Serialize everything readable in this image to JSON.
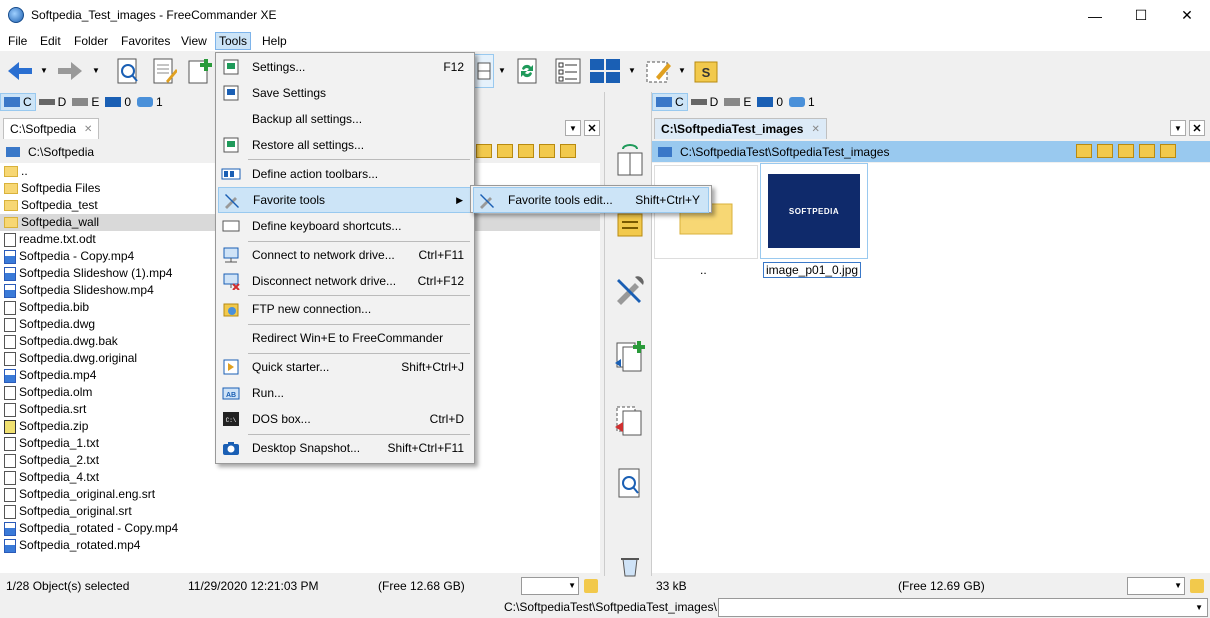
{
  "window": {
    "title": "Softpedia_Test_images - FreeCommander XE",
    "minimize": "—",
    "maximize": "☐",
    "close": "✕"
  },
  "menu": [
    "File",
    "Edit",
    "Folder",
    "Favorites",
    "View",
    "Tools",
    "Help"
  ],
  "left": {
    "drives": [
      "C",
      "D",
      "E",
      "0",
      "1"
    ],
    "tab": "C:\\Softpedia",
    "path": "C:\\Softpedia",
    "files": [
      {
        "name": "..",
        "type": "folder"
      },
      {
        "name": "Softpedia Files",
        "type": "folder"
      },
      {
        "name": "Softpedia_test",
        "type": "folder"
      },
      {
        "name": "Softpedia_wall",
        "type": "folder"
      },
      {
        "name": "readme.txt.odt",
        "type": "file"
      },
      {
        "name": "Softpedia - Copy.mp4",
        "type": "media"
      },
      {
        "name": "Softpedia Slideshow (1).mp4",
        "type": "media"
      },
      {
        "name": "Softpedia Slideshow.mp4",
        "type": "media"
      },
      {
        "name": "Softpedia.bib",
        "type": "file"
      },
      {
        "name": "Softpedia.dwg",
        "type": "file"
      },
      {
        "name": "Softpedia.dwg.bak",
        "type": "file"
      },
      {
        "name": "Softpedia.dwg.original",
        "type": "file"
      },
      {
        "name": "Softpedia.mp4",
        "type": "media"
      },
      {
        "name": "Softpedia.olm",
        "type": "file"
      },
      {
        "name": "Softpedia.srt",
        "type": "file"
      },
      {
        "name": "Softpedia.zip",
        "type": "zip"
      },
      {
        "name": "Softpedia_1.txt",
        "type": "file"
      },
      {
        "name": "Softpedia_2.txt",
        "type": "file"
      },
      {
        "name": "Softpedia_4.txt",
        "type": "file"
      },
      {
        "name": "Softpedia_original.eng.srt",
        "type": "file"
      },
      {
        "name": "Softpedia_original.srt",
        "type": "file"
      },
      {
        "name": "Softpedia_rotated - Copy.mp4",
        "type": "media"
      },
      {
        "name": "Softpedia_rotated.mp4",
        "type": "media"
      }
    ],
    "status": {
      "selected": "1/28 Object(s) selected",
      "date": "11/29/2020 12:21:03 PM",
      "free": "(Free 12.68 GB)"
    }
  },
  "right": {
    "drives": [
      "C",
      "D",
      "E",
      "0",
      "1"
    ],
    "tab": "C:\\SoftpediaTest_images",
    "path": "C:\\SoftpediaTest\\SoftpediaTest_images",
    "thumb_parent": "..",
    "thumb_image": "image_p01_0.jpg",
    "thumb_logo": "SOFTPEDIA",
    "status": {
      "size": "33 kB",
      "free": "(Free 12.69 GB)"
    }
  },
  "bottom_path": "C:\\SoftpediaTest\\SoftpediaTest_images\\",
  "tools_menu": [
    {
      "label": "Settings...",
      "shortcut": "F12"
    },
    {
      "label": "Save Settings",
      "shortcut": ""
    },
    {
      "label": "Backup all settings...",
      "shortcut": ""
    },
    {
      "label": "Restore all settings...",
      "shortcut": ""
    },
    {
      "label": "Define action toolbars...",
      "shortcut": ""
    },
    {
      "label": "Favorite tools",
      "shortcut": ""
    },
    {
      "label": "Define keyboard shortcuts...",
      "shortcut": ""
    },
    {
      "label": "Connect to network drive...",
      "shortcut": "Ctrl+F11"
    },
    {
      "label": "Disconnect network drive...",
      "shortcut": "Ctrl+F12"
    },
    {
      "label": "FTP new connection...",
      "shortcut": ""
    },
    {
      "label": "Redirect Win+E to FreeCommander",
      "shortcut": ""
    },
    {
      "label": "Quick starter...",
      "shortcut": "Shift+Ctrl+J"
    },
    {
      "label": "Run...",
      "shortcut": ""
    },
    {
      "label": "DOS box...",
      "shortcut": "Ctrl+D"
    },
    {
      "label": "Desktop Snapshot...",
      "shortcut": "Shift+Ctrl+F11"
    }
  ],
  "submenu": {
    "label": "Favorite tools edit...",
    "shortcut": "Shift+Ctrl+Y"
  },
  "colors": {
    "accent": "#cce4f7",
    "path_bar_active": "#99c9ef",
    "thumb_bg": "#0f2a6b"
  }
}
